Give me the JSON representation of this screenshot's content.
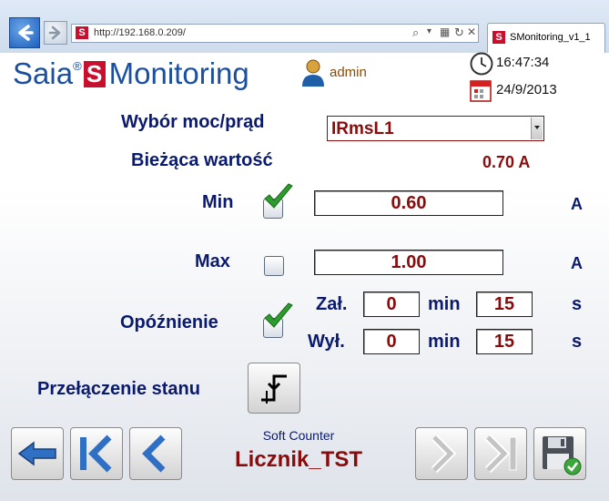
{
  "browser": {
    "url": "http://192.168.0.209/",
    "tab_title": "SMonitoring_v1_1"
  },
  "header": {
    "brand_saia": "Saia",
    "brand_reg": "®",
    "brand_s": "S",
    "brand_monitoring": "Monitoring",
    "user": "admin",
    "time": "16:47:34",
    "date": "24/9/2013"
  },
  "form": {
    "select_label": "Wybór moc/prąd",
    "select_value": "IRmsL1",
    "current_label": "Bieżąca wartość",
    "current_value": "0.70 A",
    "min_label": "Min",
    "min_checked": true,
    "min_value": "0.60",
    "min_unit": "A",
    "max_label": "Max",
    "max_checked": false,
    "max_value": "1.00",
    "max_unit": "A",
    "delay_label": "Opóźnienie",
    "delay_checked": true,
    "on_label": "Zał.",
    "on_min": "0",
    "on_min_unit": "min",
    "on_sec": "15",
    "on_sec_unit": "s",
    "off_label": "Wył.",
    "off_min": "0",
    "off_min_unit": "min",
    "off_sec": "15",
    "off_sec_unit": "s",
    "switch_label": "Przełączenie stanu"
  },
  "footer": {
    "counter_type": "Soft Counter",
    "counter_name": "Licznik_TST"
  },
  "colors": {
    "label_blue": "#0a1a6e",
    "value_red": "#8a0b0b",
    "brand_blue": "#1b4fa0",
    "brand_red": "#c8102e"
  }
}
